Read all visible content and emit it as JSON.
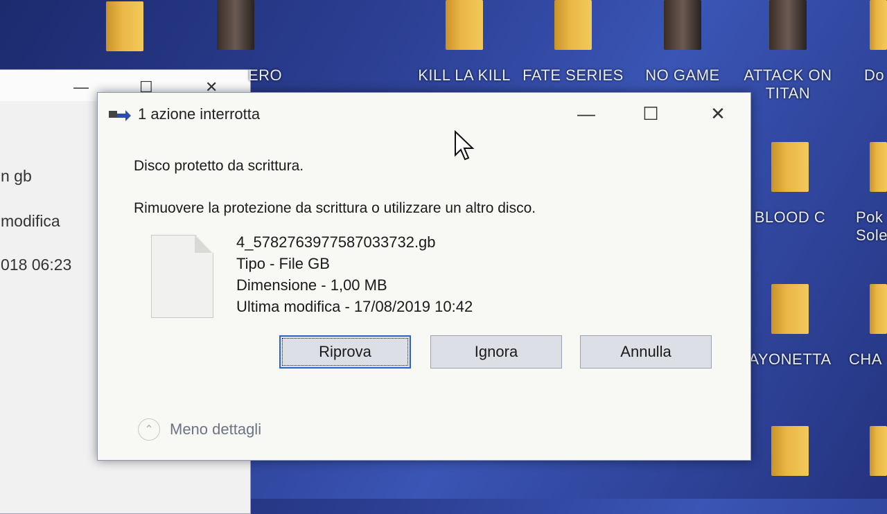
{
  "desktop": {
    "icons": [
      {
        "label": "ERO"
      },
      {
        "label": "KILL LA KILL"
      },
      {
        "label": "FATE SERIES"
      },
      {
        "label": "NO GAME"
      },
      {
        "label": "ATTACK ON\nTITAN"
      },
      {
        "label": "Do"
      },
      {
        "label": "BLOOD C"
      },
      {
        "label": "Pok\nSole"
      },
      {
        "label": "AYONETTA"
      },
      {
        "label": "CHA"
      }
    ]
  },
  "background_window": {
    "text_1": "n gb",
    "text_2": "modifica",
    "text_3": "018 06:23"
  },
  "dialog": {
    "title": "1 azione interrotta",
    "message_title": "Disco protetto da scrittura.",
    "message_body": "Rimuovere la protezione da scrittura o utilizzare un altro disco.",
    "file": {
      "name": "4_5782763977587033732.gb",
      "type": "Tipo - File GB",
      "size": "Dimensione - 1,00 MB",
      "modified": "Ultima modifica - 17/08/2019 10:42"
    },
    "buttons": {
      "retry": "Riprova",
      "ignore": "Ignora",
      "cancel": "Annulla"
    },
    "details_toggle": "Meno dettagli"
  }
}
